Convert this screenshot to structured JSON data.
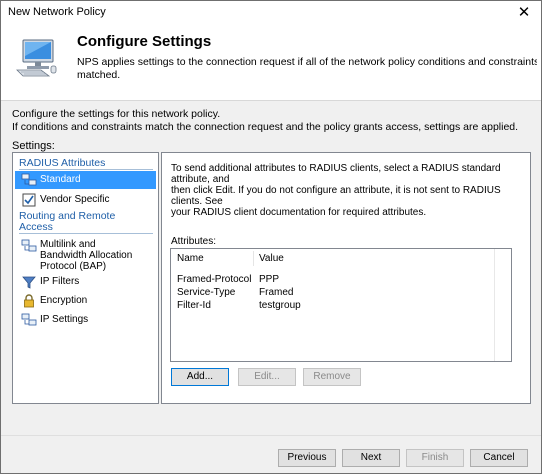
{
  "window": {
    "title": "New Network Policy",
    "close_glyph": "✕"
  },
  "header": {
    "title": "Configure Settings",
    "description_line1": "NPS applies settings to the connection request if all of the network policy conditions and constraints for the policy ar",
    "description_line2": "matched.",
    "icon": "computer-network-icon"
  },
  "intro": {
    "line1": "Configure the settings for this network policy.",
    "line2": "If conditions and constraints match the connection request and the policy grants access, settings are applied."
  },
  "settings_label": "Settings:",
  "nav": {
    "group1": "RADIUS Attributes",
    "group2_line1": "Routing and Remote",
    "group2_line2": "Access",
    "items": [
      {
        "label": "Standard",
        "icon": "network-computers-icon",
        "selected": true
      },
      {
        "label": "Vendor Specific",
        "icon": "checklist-icon",
        "selected": false
      },
      {
        "label_line1": "Multilink and",
        "label_line2": "Bandwidth Allocation",
        "label_line3": "Protocol (BAP)",
        "icon": "network-computers-icon",
        "selected": false
      },
      {
        "label": "IP Filters",
        "icon": "funnel-icon",
        "selected": false
      },
      {
        "label": "Encryption",
        "icon": "lock-icon",
        "selected": false
      },
      {
        "label": "IP Settings",
        "icon": "network-computers-icon",
        "selected": false
      }
    ]
  },
  "content": {
    "description_line1": "To send additional attributes to RADIUS clients, select a RADIUS standard attribute, and",
    "description_line2": "then click Edit. If you do not configure an attribute, it is not sent to RADIUS clients. See",
    "description_line3": "your RADIUS client documentation for required attributes.",
    "attributes_label": "Attributes:",
    "columns": [
      "Name",
      "Value"
    ],
    "rows": [
      {
        "name": "Framed-Protocol",
        "value": "PPP"
      },
      {
        "name": "Service-Type",
        "value": "Framed"
      },
      {
        "name": "Filter-Id",
        "value": "testgroup"
      }
    ],
    "buttons": {
      "add": "Add...",
      "edit": "Edit...",
      "remove": "Remove"
    }
  },
  "footer": {
    "previous": "Previous",
    "next": "Next",
    "finish": "Finish",
    "cancel": "Cancel"
  },
  "colors": {
    "selection": "#3399ff",
    "group_heading": "#1f5fa8"
  }
}
